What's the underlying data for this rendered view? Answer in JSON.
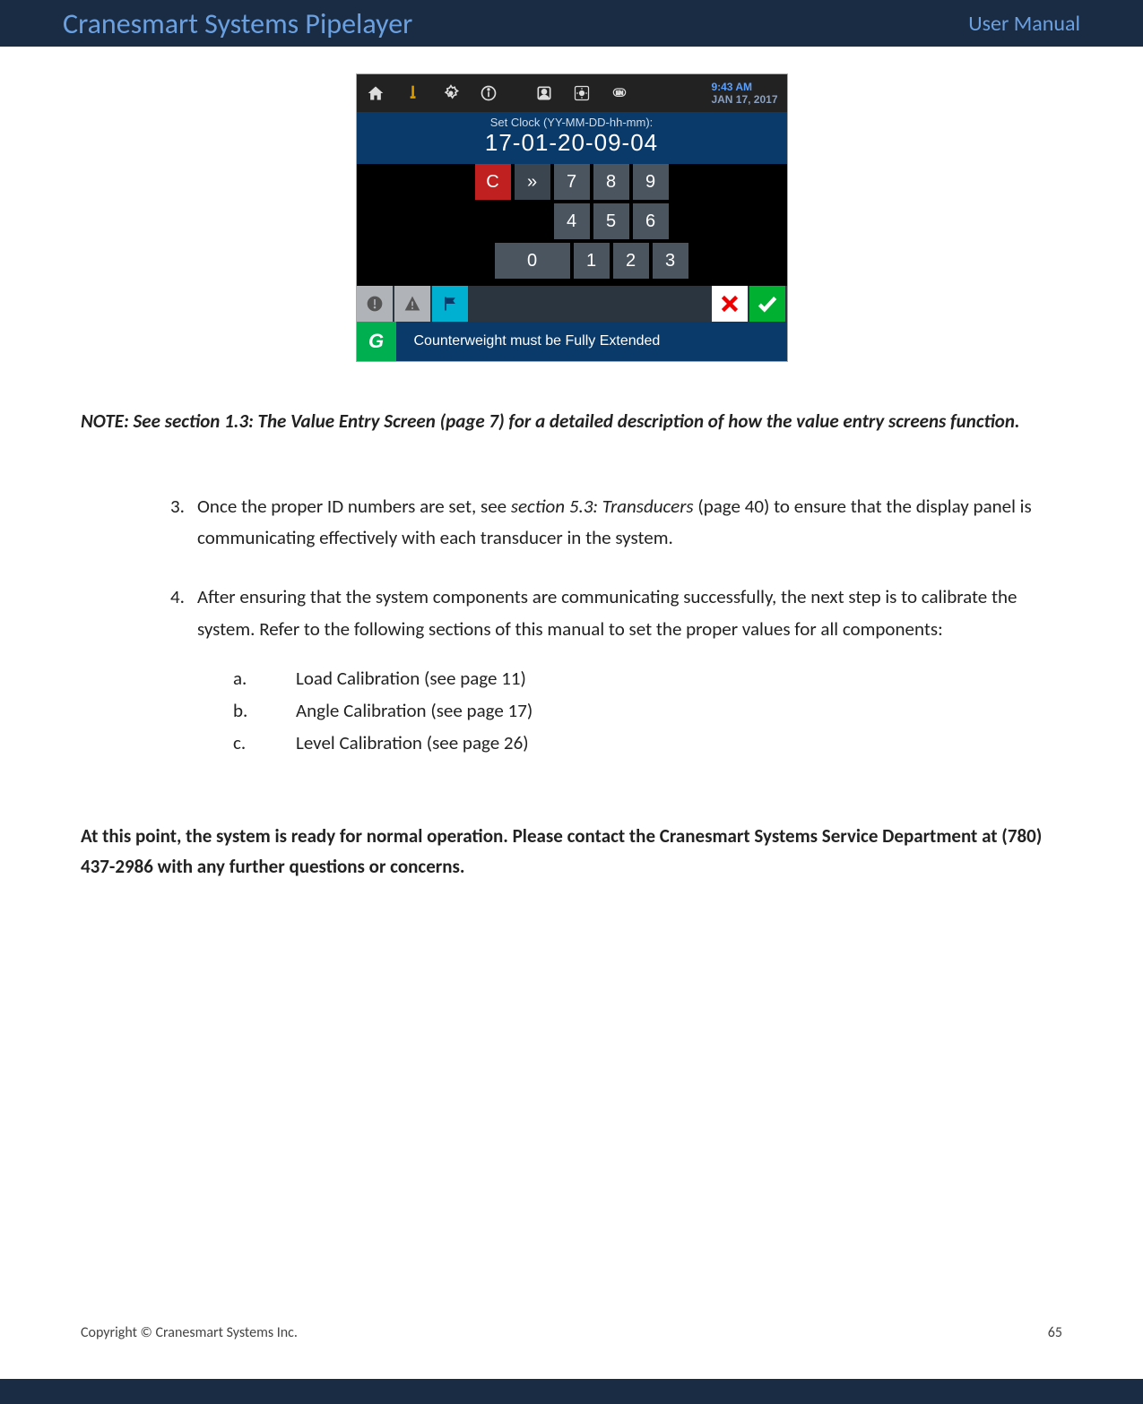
{
  "header": {
    "left": "Cranesmart Systems Pipelayer",
    "right": "User Manual"
  },
  "device": {
    "time": "9:43 AM",
    "date": "JAN 17, 2017",
    "clock_label": "Set Clock (YY-MM-DD-hh-mm):",
    "clock_value": "17-01-20-09-04",
    "keys": {
      "c": "C",
      "nav": "»",
      "k7": "7",
      "k8": "8",
      "k9": "9",
      "k4": "4",
      "k5": "5",
      "k6": "6",
      "k0": "0",
      "k1": "1",
      "k2": "2",
      "k3": "3"
    },
    "status_x": "×",
    "status_ok": "✓",
    "msg_icon": "G",
    "msg_text": "Counterweight must be Fully Extended"
  },
  "note": "NOTE: See section 1.3: The Value Entry Screen (page 7) for a detailed description of how the value entry screens function.",
  "step3": {
    "num": "3.",
    "pre": "Once the proper ID numbers are set, see ",
    "em": "section 5.3: Transducers",
    "post": " (page 40) to ensure that the display panel is communicating effectively with each transducer in the system."
  },
  "step4": {
    "num": "4.",
    "body": "After ensuring that the system components are communicating successfully, the next step is to calibrate the system.  Refer to the following sections of this manual to set the proper values for all components:",
    "a_let": "a.",
    "a": "Load Calibration (see page 11)",
    "b_let": "b.",
    "b": "Angle Calibration (see page 17)",
    "c_let": "c.",
    "c": "Level Calibration (see page 26)"
  },
  "final": "At this point, the system is ready for normal operation.  Please contact the Cranesmart Systems Service Department at (780) 437-2986 with any further questions or concerns.",
  "footer": {
    "copyright": "Copyright © Cranesmart Systems Inc.",
    "page": "65"
  }
}
